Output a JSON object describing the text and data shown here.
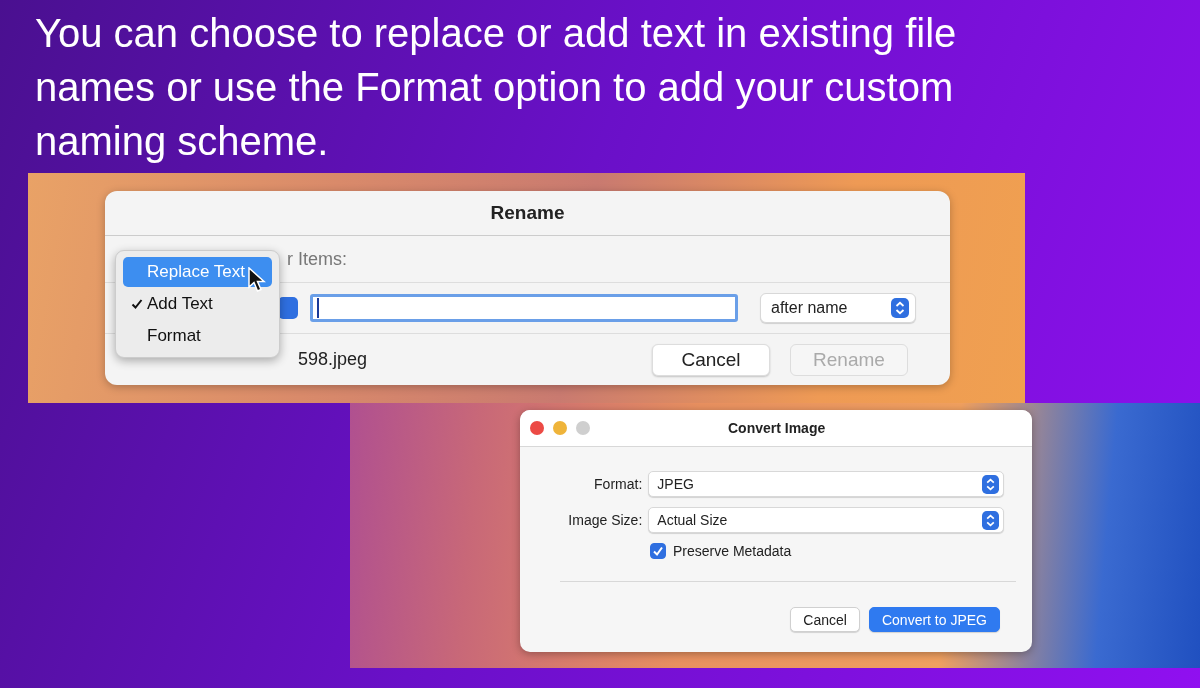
{
  "heading": "You can choose to replace or add text in existing file names or use the Format option to add your custom naming scheme.",
  "rename_dialog": {
    "title": "Rename",
    "label": "r Items:",
    "position_popup": "after name",
    "example": "598.jpeg",
    "buttons": [
      {
        "label": "Cancel",
        "disabled": false
      },
      {
        "label": "Rename",
        "disabled": true
      }
    ],
    "menu": {
      "items": [
        {
          "label": "Replace Text",
          "selected": true,
          "checked": false
        },
        {
          "label": "Add Text",
          "selected": false,
          "checked": true
        },
        {
          "label": "Format",
          "selected": false,
          "checked": false
        }
      ]
    }
  },
  "convert_dialog": {
    "title": "Convert Image",
    "fields": [
      {
        "label": "Format:",
        "value": "JPEG"
      },
      {
        "label": "Image Size:",
        "value": "Actual Size"
      }
    ],
    "checkbox": {
      "label": "Preserve Metadata",
      "checked": true
    },
    "buttons": [
      {
        "label": "Cancel",
        "primary": false
      },
      {
        "label": "Convert to JPEG",
        "primary": true
      }
    ]
  }
}
